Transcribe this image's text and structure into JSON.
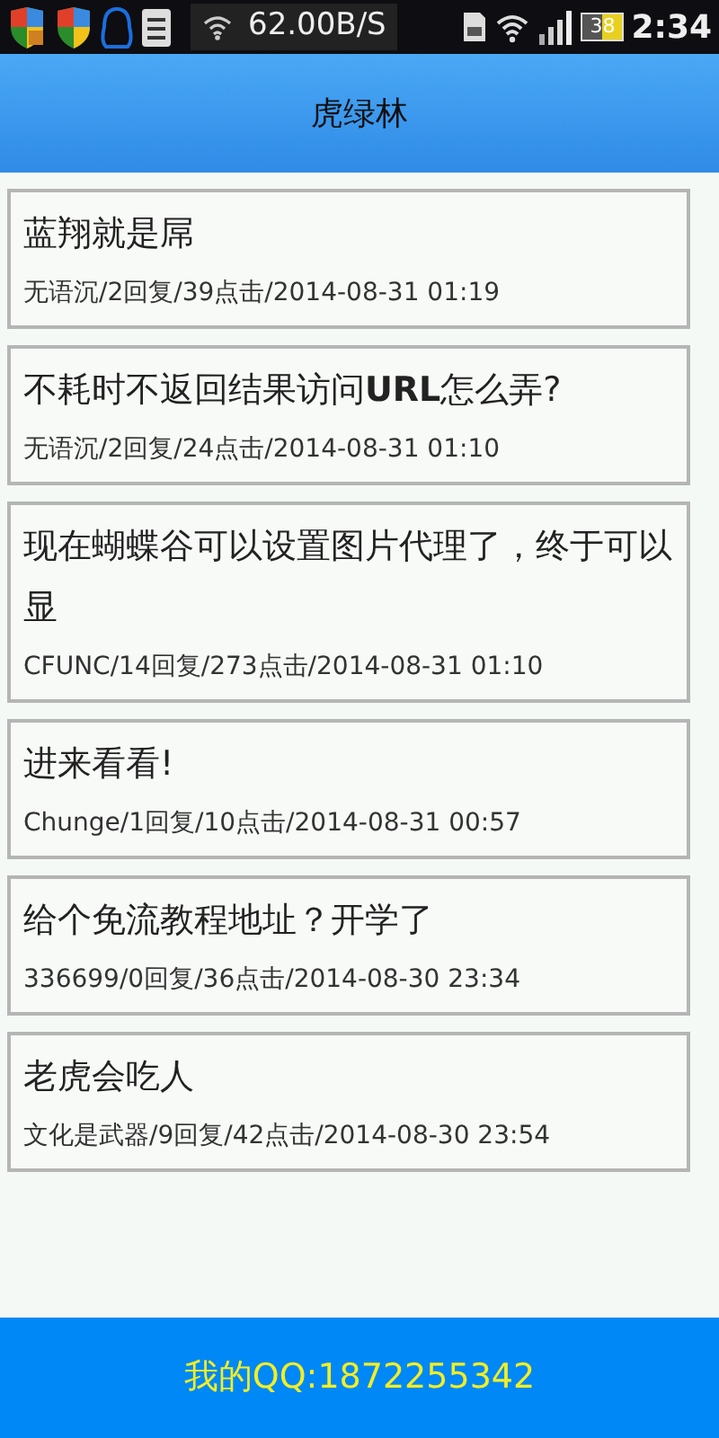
{
  "status_bar": {
    "speed": "62.00B/S",
    "battery": "38",
    "time": "2:34"
  },
  "header": {
    "title": "虎绿林"
  },
  "topics": [
    {
      "title": "蓝翔就是屌",
      "meta": "无语沉/2回复/39点击/2014-08-31 01:19"
    },
    {
      "title": "不耗时不返回结果访问**URL**怎么弄?",
      "meta": "无语沉/2回复/24点击/2014-08-31 01:10"
    },
    {
      "title": "现在蝴蝶谷可以设置图片代理了，终于可以显",
      "meta": "CFUNC/14回复/273点击/2014-08-31 01:10"
    },
    {
      "title": "进来看看!",
      "meta": "Chunge/1回复/10点击/2014-08-31 00:57"
    },
    {
      "title": "给个免流教程地址？开学了",
      "meta": "336699/0回复/36点击/2014-08-30 23:34"
    },
    {
      "title": "老虎会吃人",
      "meta": "文化是武器/9回复/42点击/2014-08-30 23:54"
    }
  ],
  "footer": {
    "text": "我的QQ:1872255342"
  }
}
